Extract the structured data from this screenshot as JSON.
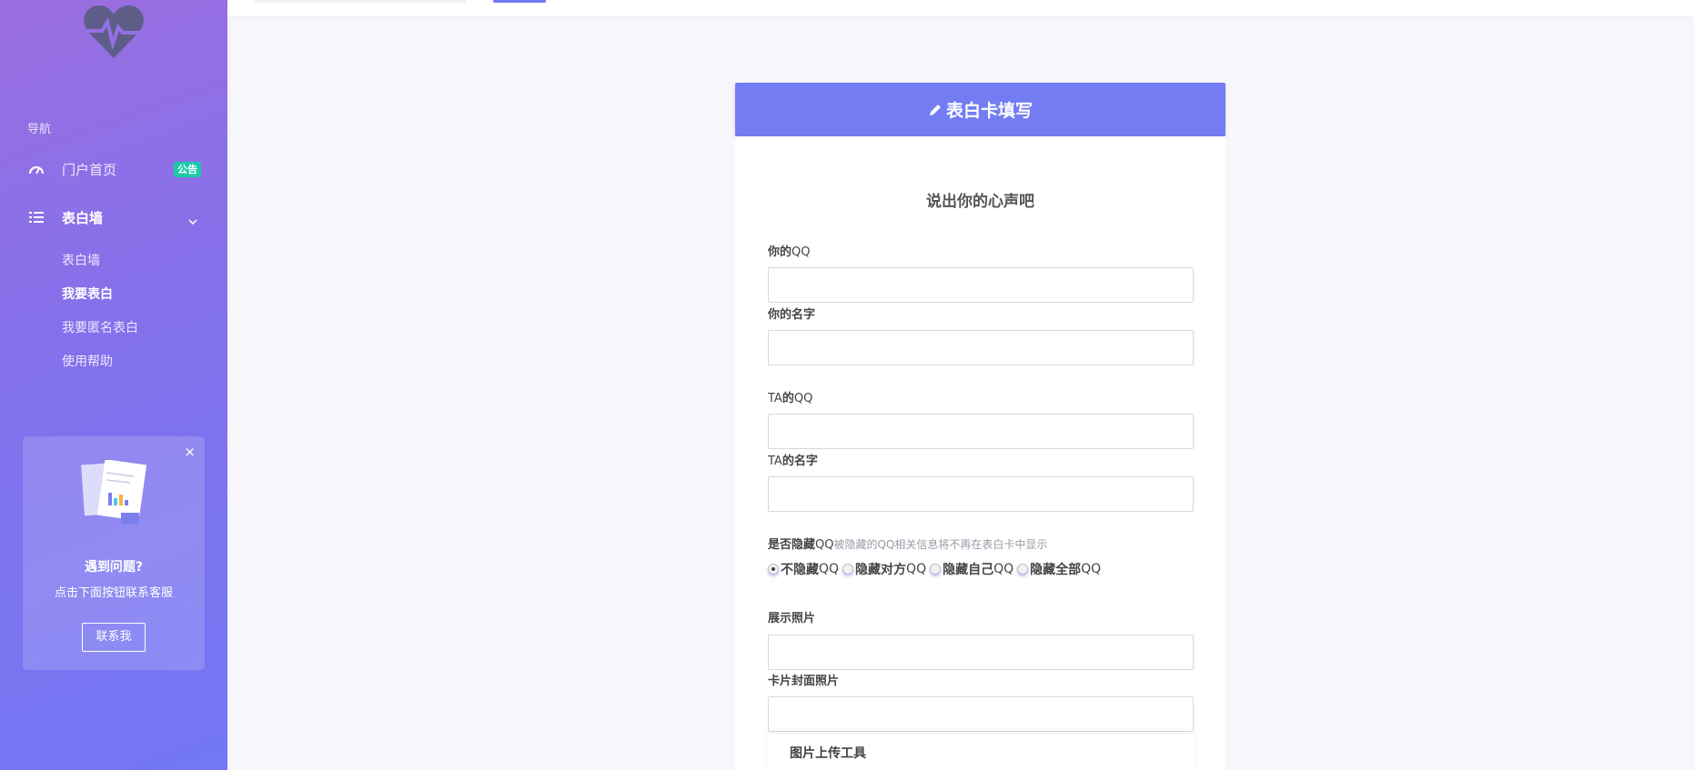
{
  "sidebar": {
    "logo_icon": "heart-pulse-icon",
    "nav_heading": "导航",
    "items": [
      {
        "label": "门户首页",
        "icon": "gauge-icon",
        "badge": "公告"
      },
      {
        "label": "表白墙",
        "icon": "list-icon"
      }
    ],
    "sub_items": [
      {
        "label": "表白墙"
      },
      {
        "label": "我要表白"
      },
      {
        "label": "我要匿名表白"
      },
      {
        "label": "使用帮助"
      }
    ],
    "help_card": {
      "title": "遇到问题?",
      "text": "点击下面按钮联系客服",
      "button": "联系我",
      "close": "×"
    }
  },
  "card": {
    "header": "表白卡填写",
    "subtitle": "说出你的心声吧",
    "fields": {
      "your_qq": {
        "label_cn": "你的",
        "label_latin": "QQ",
        "value": ""
      },
      "your_name": {
        "label": "你的名字",
        "value": ""
      },
      "ta_qq": {
        "label_latin": "TA",
        "label_cn": "的",
        "label_latin2": "QQ",
        "value": ""
      },
      "ta_name": {
        "label_latin": "TA",
        "label_cn": "的名字",
        "value": ""
      },
      "hide_qq": {
        "label_cn": "是否隐藏",
        "label_latin": "QQ",
        "hint": "被隐藏的QQ相关信息将不再在表白卡中显示",
        "options": [
          {
            "cn": "不隐藏",
            "latin": "QQ",
            "checked": true
          },
          {
            "cn": "隐藏对方",
            "latin": "QQ",
            "checked": false
          },
          {
            "cn": "隐藏自己",
            "latin": "QQ",
            "checked": false
          },
          {
            "cn": "隐藏全部",
            "latin": "QQ",
            "checked": false
          }
        ]
      },
      "photo": {
        "label": "展示照片",
        "value": ""
      },
      "cover": {
        "label": "卡片封面照片",
        "value": ""
      }
    },
    "upload_tool": "图片上传工具"
  },
  "colors": {
    "sidebar_gradient_start": "#9a6ee0",
    "sidebar_gradient_end": "#7277f4",
    "accent": "#737cf2",
    "badge": "#1dc9a7"
  }
}
